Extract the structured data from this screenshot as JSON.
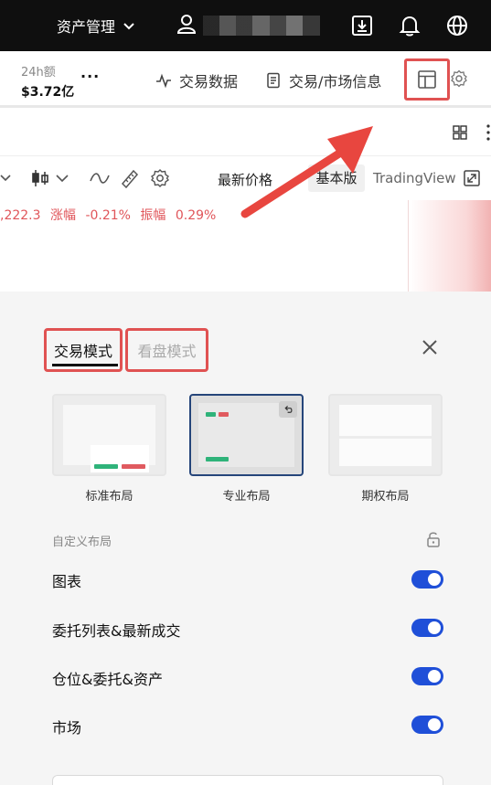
{
  "topbar": {
    "asset_menu_label": "资产管理"
  },
  "market": {
    "volume_label": "24h额",
    "volume_value": "$3.72亿",
    "more": "···",
    "trade_data_label": "交易数据",
    "trade_info_label": "交易/市场信息"
  },
  "chart": {
    "latest_price_label": "最新价格",
    "basic_version_label": "基本版",
    "tradingview_label": "TradingView",
    "quote": {
      "price_fragment": ",222.3",
      "change_label": "涨幅",
      "change_value": "-0.21%",
      "amplitude_label": "振幅",
      "amplitude_value": "0.29%"
    }
  },
  "sheet": {
    "tabs": [
      {
        "label": "交易模式",
        "active": true
      },
      {
        "label": "看盘模式",
        "active": false
      }
    ],
    "layouts": [
      {
        "label": "标准布局",
        "selected": false
      },
      {
        "label": "专业布局",
        "selected": true
      },
      {
        "label": "期权布局",
        "selected": false
      }
    ],
    "custom_layout_label": "自定义布局",
    "rows": [
      {
        "label": "图表",
        "enabled": true
      },
      {
        "label": "委托列表&最新成交",
        "enabled": true
      },
      {
        "label": "仓位&委托&资产",
        "enabled": true
      },
      {
        "label": "市场",
        "enabled": true
      }
    ]
  },
  "colors": {
    "accent_blue": "#1f4fd8",
    "highlight_red": "#e05252",
    "up_green": "#2fb37a",
    "down_red": "#e05a5f",
    "topbar_bg": "#0f0f0f"
  }
}
